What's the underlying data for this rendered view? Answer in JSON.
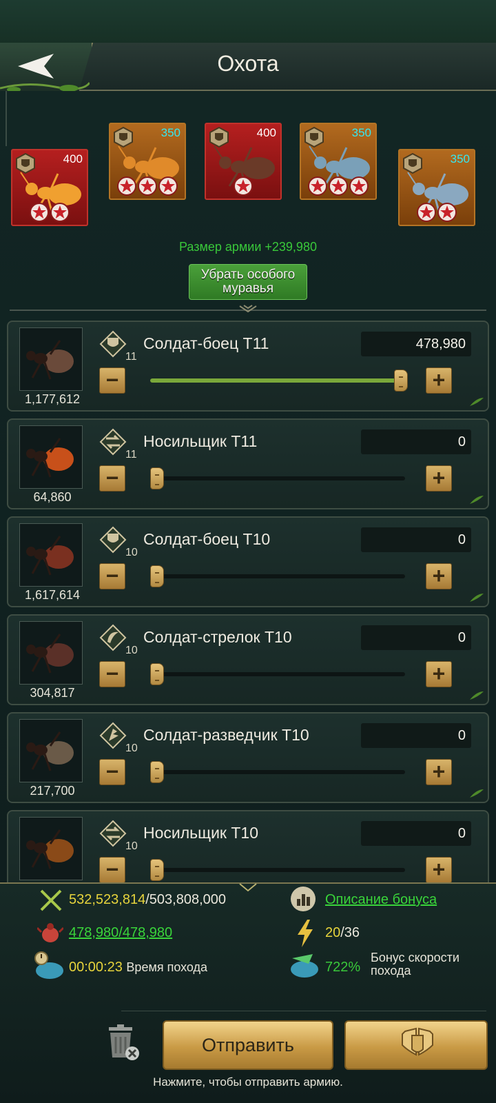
{
  "header": {
    "title": "Охота"
  },
  "special_ants": [
    {
      "value": "400",
      "value_color": "white",
      "bg": "red",
      "stars": 2
    },
    {
      "value": "350",
      "value_color": "cyan",
      "bg": "orange",
      "stars": 3
    },
    {
      "value": "400",
      "value_color": "white",
      "bg": "red",
      "stars": 1
    },
    {
      "value": "350",
      "value_color": "cyan",
      "bg": "orange",
      "stars": 3
    },
    {
      "value": "350",
      "value_color": "cyan",
      "bg": "orange",
      "stars": 2
    }
  ],
  "army_size_label": "Размер армии +239,980",
  "remove_special_button": "Убрать особого муравья",
  "units": [
    {
      "name": "Солдат-боец T11",
      "level": "11",
      "icon": "shield-class-icon",
      "count": "1,177,612",
      "value": "478,980",
      "fill_fraction": 1.0
    },
    {
      "name": "Носильщик T11",
      "level": "11",
      "icon": "carrier-class-icon",
      "count": "64,860",
      "value": "0",
      "fill_fraction": 0
    },
    {
      "name": "Солдат-боец T10",
      "level": "10",
      "icon": "shield-class-icon",
      "count": "1,617,614",
      "value": "0",
      "fill_fraction": 0
    },
    {
      "name": "Солдат-стрелок T10",
      "level": "10",
      "icon": "shooter-class-icon",
      "count": "304,817",
      "value": "0",
      "fill_fraction": 0
    },
    {
      "name": "Солдат-разведчик T10",
      "level": "10",
      "icon": "scout-class-icon",
      "count": "217,700",
      "value": "0",
      "fill_fraction": 0
    },
    {
      "name": "Носильщик T10",
      "level": "10",
      "icon": "carrier-class-icon",
      "count": "",
      "value": "0",
      "fill_fraction": 0
    }
  ],
  "stats": {
    "power_current": "532,523,814",
    "power_total": "/503,808,000",
    "bonus_description": "Описание бонуса",
    "army_load": "478,980/478,980",
    "energy_current": "20",
    "energy_total": "/36",
    "march_time": "00:00:23",
    "march_time_label": "Время похода",
    "speed_bonus": "722%",
    "speed_bonus_label": "Бонус скорости похода"
  },
  "send_button": "Отправить",
  "hint": "Нажмите, чтобы отправить армию.",
  "colors": {
    "accent_green": "#39c83a",
    "gold": "#c99a45",
    "value_yellow": "#e6d33c"
  }
}
